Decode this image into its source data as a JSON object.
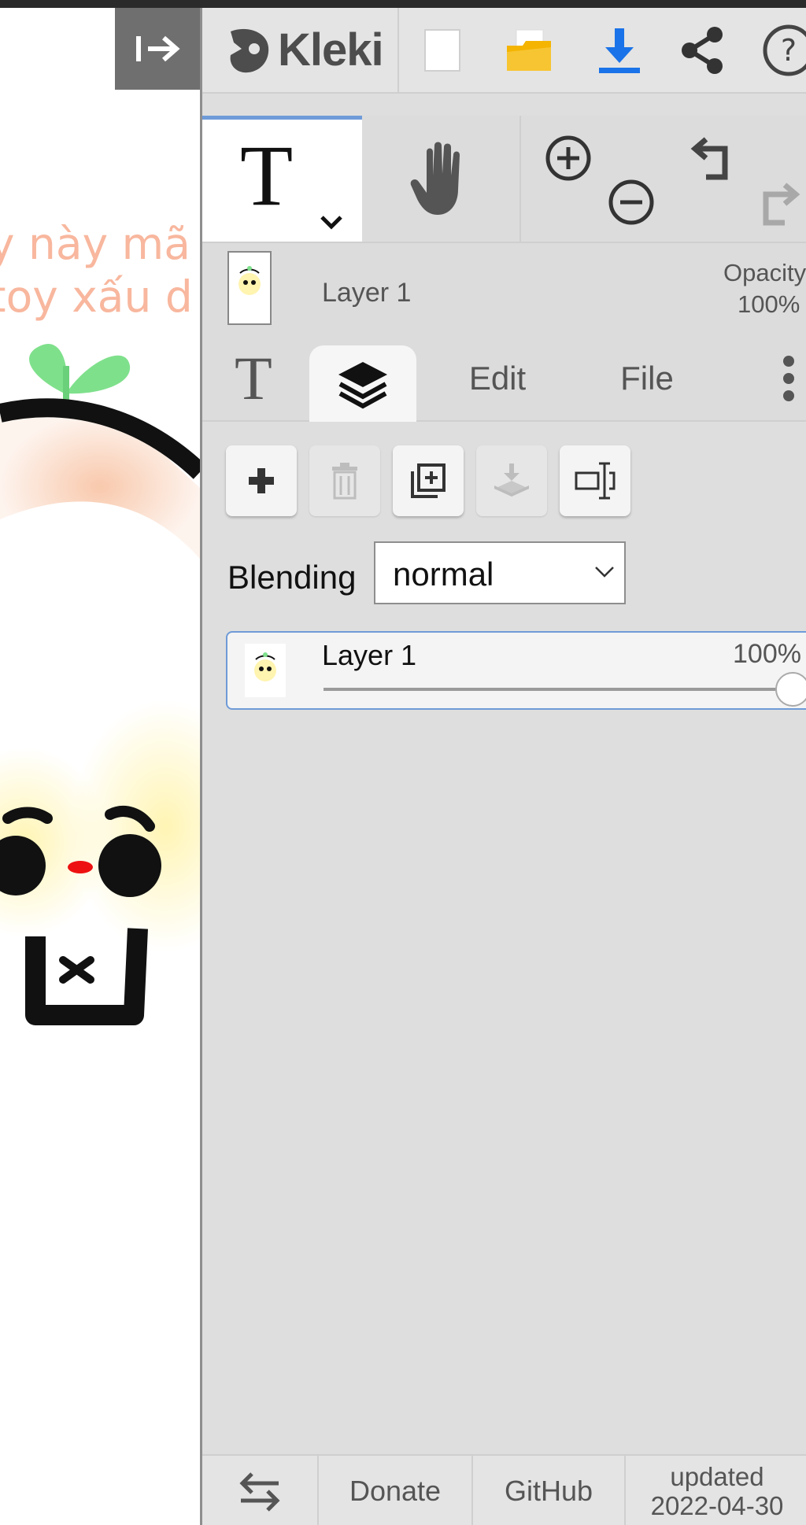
{
  "canvas": {
    "text_line1": "y này mã s",
    "text_line2": "toy xấu d"
  },
  "collapse": {
    "icon": "collapse-arrow-icon"
  },
  "header": {
    "logo_text": "Kleki",
    "buttons": [
      "new-image-icon",
      "open-folder-icon",
      "download-icon",
      "share-icon",
      "help-icon"
    ]
  },
  "tools": {
    "brush_symbol": "T",
    "selected": "text-tool"
  },
  "layer_info": {
    "name": "Layer 1",
    "opacity_label": "Opacity",
    "opacity_value": "100%"
  },
  "tabs": {
    "tool_symbol": "T",
    "edit": "Edit",
    "file": "File"
  },
  "layers": {
    "blending_label": "Blending",
    "blending_value": "normal",
    "items": [
      {
        "name": "Layer 1",
        "opacity": "100%",
        "opacity_fraction": 1.0
      }
    ]
  },
  "footer": {
    "donate": "Donate",
    "github": "GitHub",
    "updated_label": "updated",
    "updated_date": "2022-04-30"
  },
  "colors": {
    "accent": "#6f9bd8",
    "download_blue": "#1a73e8",
    "folder_yellow": "#f4b400",
    "panel_bg": "#dedede"
  }
}
